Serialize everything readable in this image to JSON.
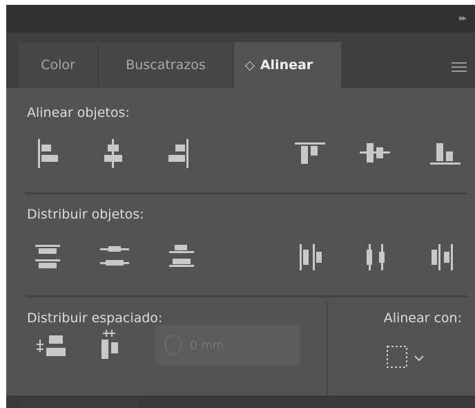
{
  "panel": {
    "tabs": [
      {
        "label": "Color"
      },
      {
        "label": "Buscatrazos"
      },
      {
        "label": "Alinear",
        "active": true
      }
    ],
    "collapse_glyph": "▸▸",
    "menu_icon": "hamburger-menu-icon",
    "tab_arrows_glyph": "◇"
  },
  "align_objects": {
    "title": "Alinear objetos:",
    "icons": [
      "align-left-icon",
      "align-horizontal-center-icon",
      "align-right-icon",
      "align-top-icon",
      "align-vertical-center-icon",
      "align-bottom-icon"
    ]
  },
  "distribute_objects": {
    "title": "Distribuir objetos:",
    "icons": [
      "distribute-top-icon",
      "distribute-vertical-center-icon",
      "distribute-bottom-icon",
      "distribute-left-icon",
      "distribute-horizontal-center-icon",
      "distribute-right-icon"
    ]
  },
  "distribute_spacing": {
    "title": "Distribuir espaciado:",
    "value_placeholder": "0 mm",
    "icons": [
      "vertical-distribute-space-icon",
      "horizontal-distribute-space-icon"
    ]
  },
  "align_to": {
    "title": "Alinear con:",
    "icon": "align-to-selection-icon"
  },
  "colors": {
    "panel_bg": "#535353",
    "tab_bar": "#3f3f3f",
    "icon": "#c8c8c8",
    "text": "#dcdcdc"
  }
}
